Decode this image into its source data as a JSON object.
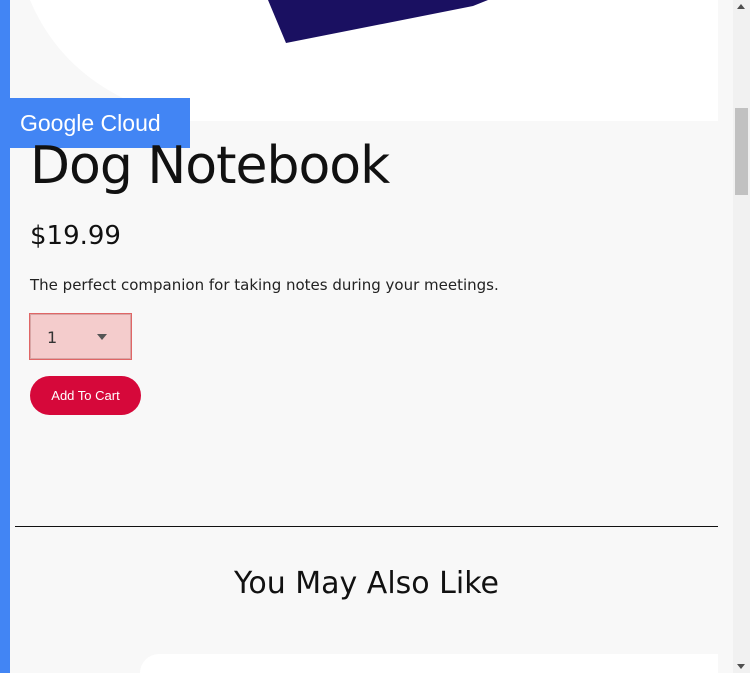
{
  "brand": {
    "badge_label": "Google Cloud",
    "accent_color": "#4285f4"
  },
  "product": {
    "name": "Dog Notebook",
    "price": "$19.99",
    "description": "The perfect companion for taking notes during your meetings.",
    "quantity": {
      "selected": "1",
      "icon": "caret-down-icon"
    },
    "add_to_cart_label": "Add To Cart",
    "add_to_cart_color": "#d6083a"
  },
  "recommendations": {
    "title": "You May Also Like"
  },
  "colors": {
    "page_background": "#f8f8f8",
    "notebook": "#1a1061"
  }
}
